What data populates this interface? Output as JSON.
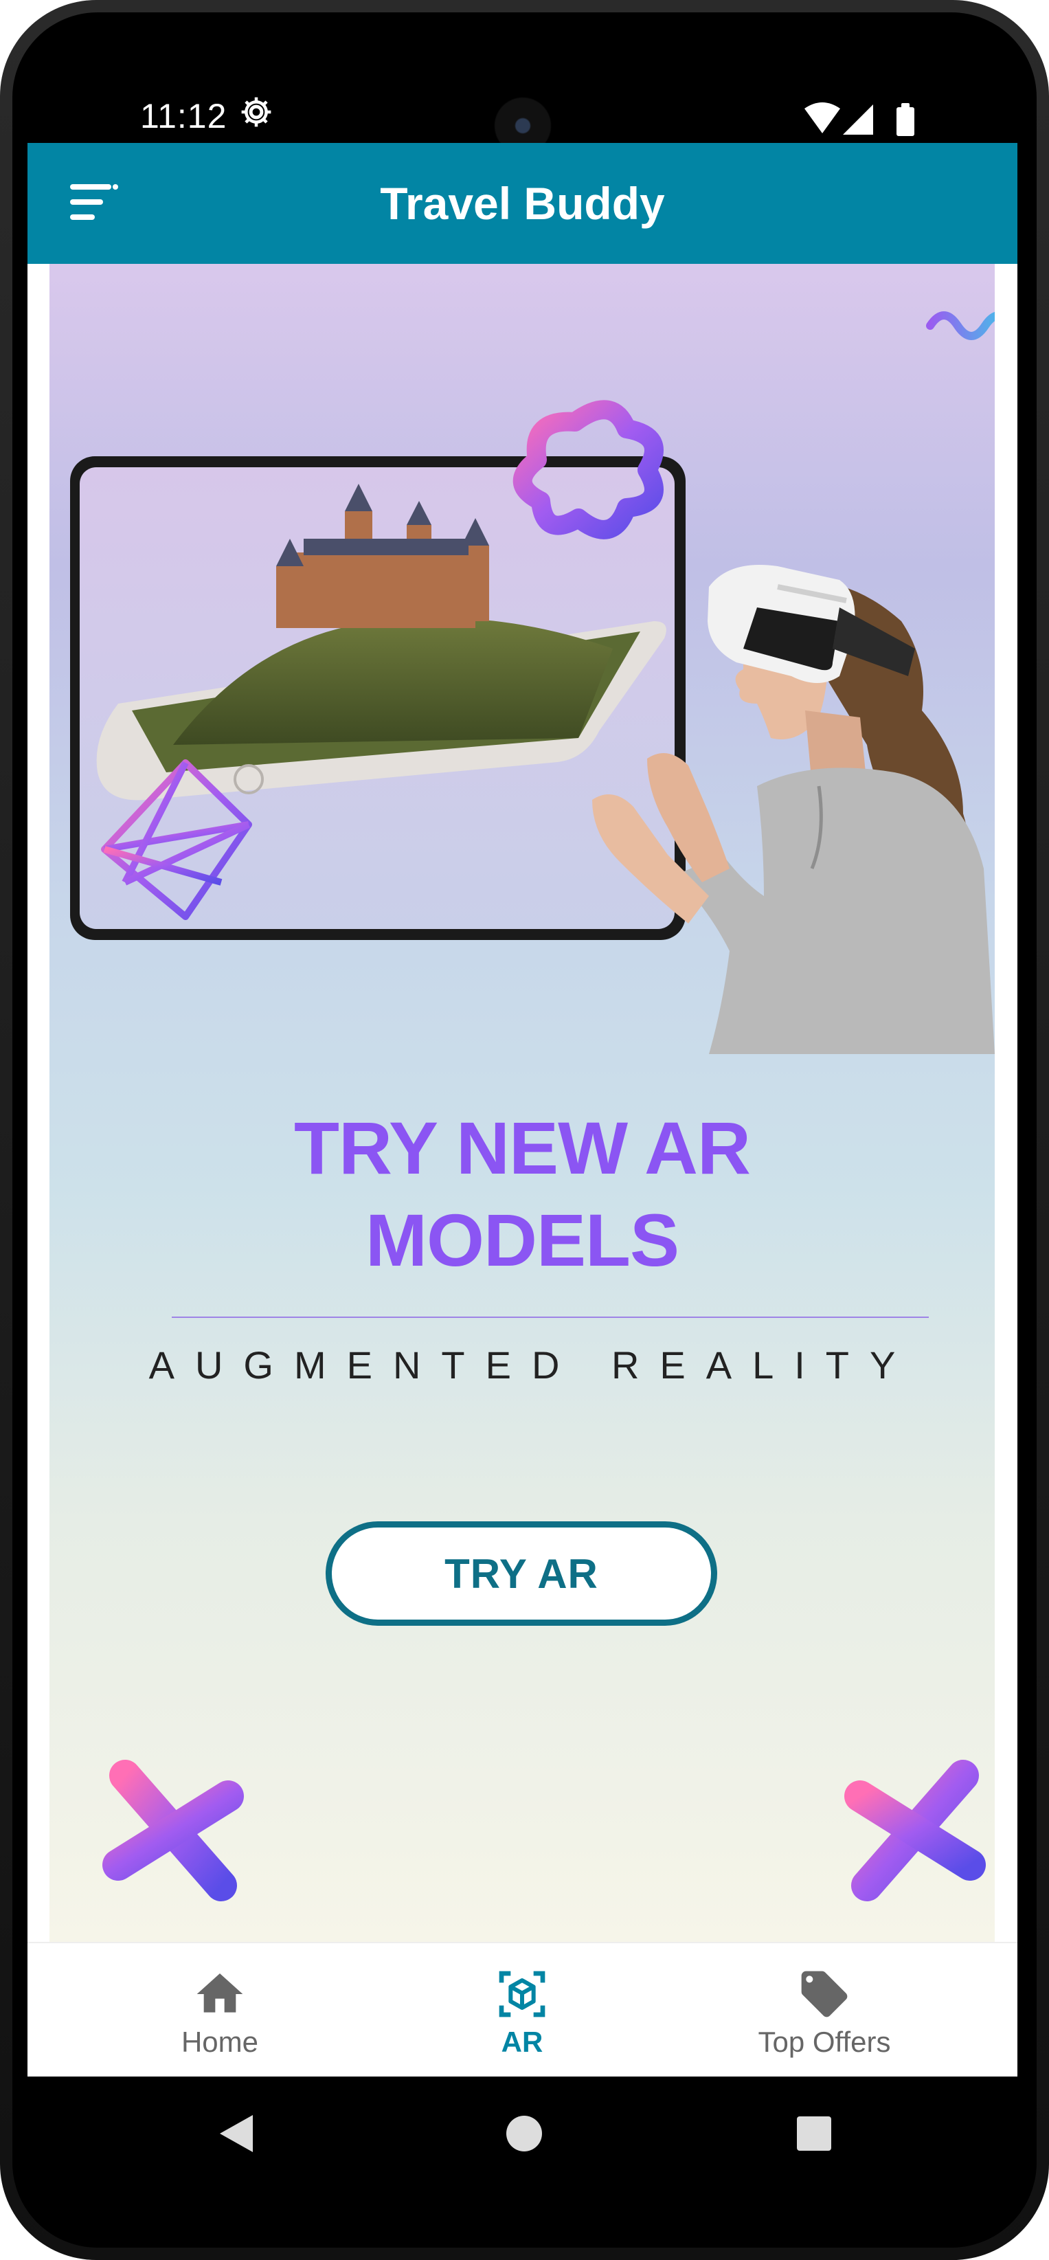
{
  "status_bar": {
    "time": "11:12",
    "icons": [
      "settings-gear-icon",
      "wifi-icon",
      "signal-icon",
      "battery-icon"
    ]
  },
  "app_bar": {
    "title": "Travel Buddy",
    "menu_icon": "menu-icon",
    "color": "#0285a4"
  },
  "hero": {
    "headline_line1": "TRY NEW AR",
    "headline_line2": "MODELS",
    "subline": "AUGMENTED REALITY",
    "button_label": "TRY AR",
    "headline_color": "#8b55f3",
    "button_color": "#0e6f86"
  },
  "bottom_nav": {
    "items": [
      {
        "label": "Home",
        "icon": "home-icon",
        "active": false
      },
      {
        "label": "AR",
        "icon": "ar-cube-icon",
        "active": true
      },
      {
        "label": "Top Offers",
        "icon": "tag-icon",
        "active": false
      }
    ],
    "active_color": "#0285a4"
  },
  "system_nav": {
    "icons": [
      "back-icon",
      "home-circle-icon",
      "recents-icon"
    ]
  }
}
